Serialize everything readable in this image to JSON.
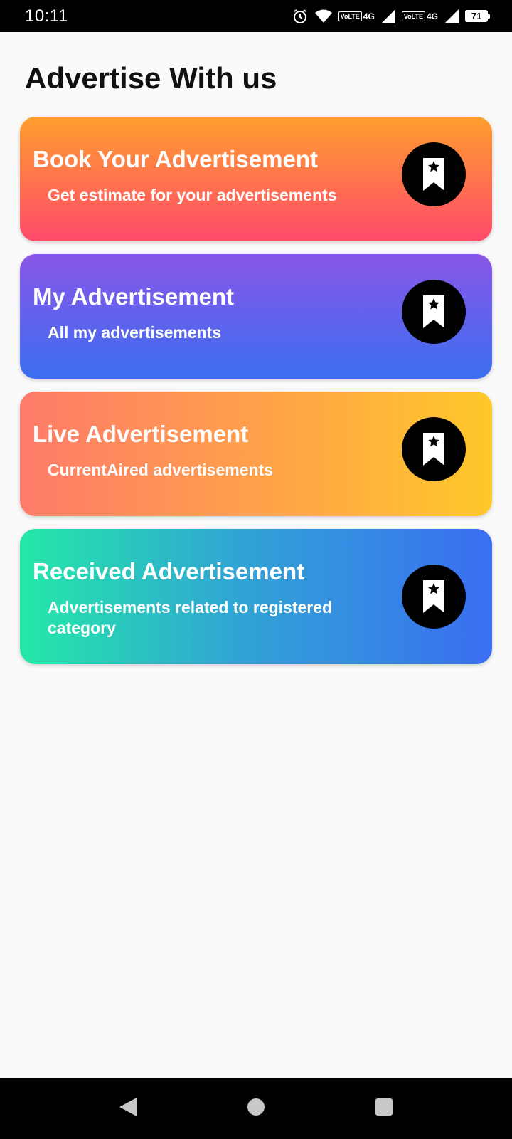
{
  "status_bar": {
    "time": "10:11",
    "network_1": "4G",
    "network_2": "4G",
    "volte_1": "VoLTE",
    "volte_2": "VoLTE",
    "battery": "71",
    "icons": [
      "alarm-icon",
      "wifi-icon",
      "signal-icon",
      "signal-icon",
      "battery-icon"
    ]
  },
  "page": {
    "title": "Advertise With us"
  },
  "cards": [
    {
      "title": "Book Your Advertisement",
      "subtitle": "Get estimate for your advertisements",
      "icon": "bookmark-star-icon",
      "gradient": [
        "#ff9f2f",
        "#ff4a6a"
      ]
    },
    {
      "title": "My Advertisement",
      "subtitle": "All my advertisements",
      "icon": "bookmark-star-icon",
      "gradient": [
        "#8a56e8",
        "#3b6ef0"
      ]
    },
    {
      "title": "Live Advertisement",
      "subtitle": "CurrentAired advertisements",
      "icon": "bookmark-star-icon",
      "gradient": [
        "#ff7b6a",
        "#ffc82a"
      ]
    },
    {
      "title": "Received Advertisement",
      "subtitle": "Advertisements related to registered category",
      "icon": "bookmark-star-icon",
      "gradient": [
        "#24e8a8",
        "#3a6ef2"
      ]
    }
  ],
  "nav_bar": {
    "buttons": [
      "back-icon",
      "home-icon",
      "recents-icon"
    ]
  }
}
